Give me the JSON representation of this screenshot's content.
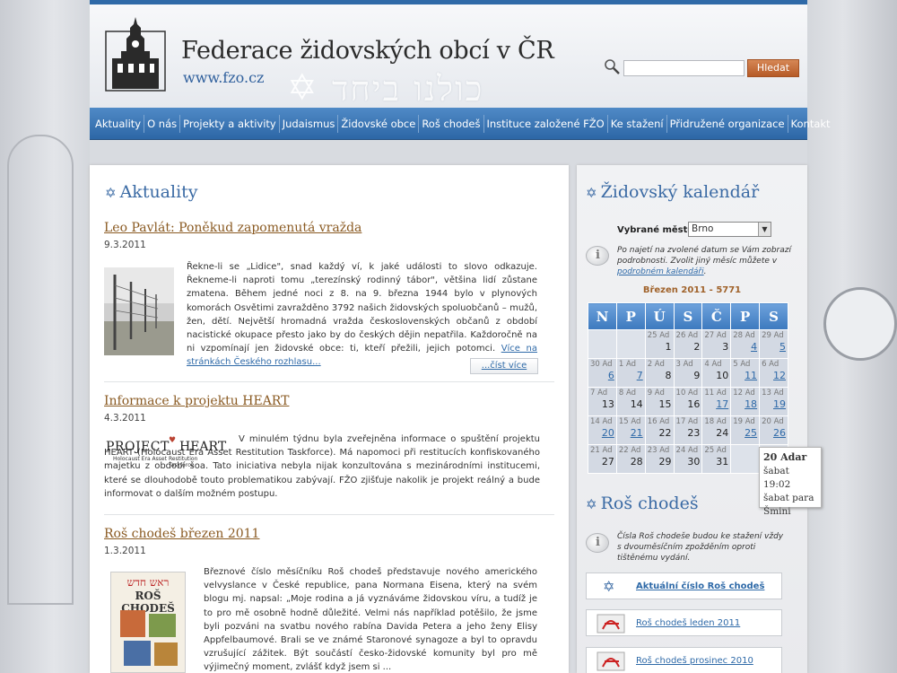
{
  "site": {
    "title": "Federace židovských obcí v ČR",
    "url": "www.fzo.cz",
    "hebrew_motto": "כולנו ביחד"
  },
  "search": {
    "placeholder": "",
    "button_label": "Hledat"
  },
  "nav": [
    "Aktuality",
    "O nás",
    "Projekty a aktivity",
    "Judaismus",
    "Židovské obce",
    "Roš chodeš",
    "Instituce založené FŽO",
    "Ke stažení",
    "Přidružené organizace",
    "Kontakt"
  ],
  "news": {
    "heading": "Aktuality",
    "articles": [
      {
        "title": "Leo Pavlát: Poněkud zapomenutá vražda",
        "date": "9.3.2011",
        "body": "Řekne-li se „Lidice\", snad každý ví, k jaké události to slovo odkazuje. Řekneme-li naproti tomu „terezínský rodinný tábor\", většina lidí zůstane zmatena. Během jedné noci z 8. na 9. března 1944 bylo v plynových komorách Osvětimi zavražděno 3792 našich židovských spoluobčanů – mužů, žen, dětí. Největší hromadná vražda československých občanů z období nacistické okupace přesto jako by do českých dějin nepatřila. Každoročně na ni vzpomínají jen židovské obce: ti, kteří přežili, jejich potomci. ",
        "link": "Více na stránkách Českého rozhlasu...",
        "more": "...číst více"
      },
      {
        "title": "Informace k projektu HEART",
        "date": "4.3.2011",
        "body": "V minulém týdnu byla zveřejněna informace o spuštění projektu HEART (Holocaust Era Asset Restitution Taskforce). Má napomoci při restitucích konfiskovaného majetku z období šoa. Tato iniciativa nebyla nijak konzultována s mezinárodními institucemi, které se dlouhodobě touto problematikou zabývají. FŽO zjišťuje nakolik je projekt reálný a bude informovat o dalším možném postupu.",
        "logo_main": "PROJECT",
        "logo_heart": "HEART",
        "logo_sub1": "Holocaust Era Asset",
        "logo_sub2": "Restitution Taskforce"
      },
      {
        "title": "Roš chodeš březen 2011",
        "date": "1.3.2011",
        "body": "Březnové číslo měsíčníku Roš chodeš představuje nového amerického velvyslance v České republice, pana Normana Eisena, který na svém blogu mj. napsal: „Moje rodina a já vyznáváme židovskou víru, a tudíž je to pro mě osobně hodně důležité. Velmi nás například potěšilo, že jsme byli pozváni na svatbu nového rabína Davida Petera a jeho ženy Elisy Appfelbaumové. Brali se ve známé Staronové synagoze a byl to opravdu vzrušující zážitek. Být součástí česko-židovské komunity byl pro mě výjimečný moment, zvlášť když jsem si ...",
        "cover_hebrew": "ראש חדש",
        "cover_title": "ROŠ CHODEŠ"
      }
    ]
  },
  "calendar": {
    "heading": "Židovský kalendář",
    "city_label": "Vybrané město:",
    "city_value": "Brno",
    "info_text": "Po najetí na zvolené datum se Vám zobrazí podrobnosti. Zvolit jiný měsíc můžete v ",
    "info_link": "podrobném kalendáři",
    "info_end": ".",
    "month": "Březen 2011 - 5771",
    "weekdays": [
      "N",
      "P",
      "Ú",
      "S",
      "Č",
      "P",
      "S"
    ],
    "weeks": [
      [
        null,
        null,
        {
          "h": "25 Ad",
          "d": "1"
        },
        {
          "h": "26 Ad",
          "d": "2"
        },
        {
          "h": "27 Ad",
          "d": "3"
        },
        {
          "h": "28 Ad",
          "d": "4",
          "sat": true
        },
        {
          "h": "29 Ad",
          "d": "5",
          "sat": true
        }
      ],
      [
        {
          "h": "30 Ad",
          "d": "6",
          "sat": true
        },
        {
          "h": "1 Ad",
          "d": "7",
          "sat": true
        },
        {
          "h": "2 Ad",
          "d": "8"
        },
        {
          "h": "3 Ad",
          "d": "9"
        },
        {
          "h": "4 Ad",
          "d": "10"
        },
        {
          "h": "5 Ad",
          "d": "11",
          "sat": true
        },
        {
          "h": "6 Ad",
          "d": "12",
          "sat": true
        }
      ],
      [
        {
          "h": "7 Ad",
          "d": "13"
        },
        {
          "h": "8 Ad",
          "d": "14"
        },
        {
          "h": "9 Ad",
          "d": "15"
        },
        {
          "h": "10 Ad",
          "d": "16"
        },
        {
          "h": "11 Ad",
          "d": "17",
          "sat": true
        },
        {
          "h": "12 Ad",
          "d": "18",
          "sat": true
        },
        {
          "h": "13 Ad",
          "d": "19",
          "sat": true
        }
      ],
      [
        {
          "h": "14 Ad",
          "d": "20",
          "sat": true
        },
        {
          "h": "15 Ad",
          "d": "21",
          "sat": true
        },
        {
          "h": "16 Ad",
          "d": "22"
        },
        {
          "h": "17 Ad",
          "d": "23"
        },
        {
          "h": "18 Ad",
          "d": "24"
        },
        {
          "h": "19 Ad",
          "d": "25",
          "sat": true
        },
        {
          "h": "20 Ad",
          "d": "26",
          "sat": true
        }
      ],
      [
        {
          "h": "21 Ad",
          "d": "27"
        },
        {
          "h": "22 Ad",
          "d": "28"
        },
        {
          "h": "23 Ad",
          "d": "29"
        },
        {
          "h": "24 Ad",
          "d": "30"
        },
        {
          "h": "25 Ad",
          "d": "31"
        },
        null,
        null
      ]
    ],
    "tooltip": {
      "title": "20 Adar",
      "line1": "šabat 19:02",
      "line2": "šabat para",
      "line3": "Šmini"
    }
  },
  "rosh": {
    "heading": "Roš chodeš",
    "info_text": "Čísla Roš chodeše budou ke stažení vždy s dvouměsíčním zpožděním oproti tištěnému vydání.",
    "current_label": "Aktuální číslo Roš chodeš",
    "items": [
      "Roš chodeš leden 2011",
      "Roš chodeš prosinec 2010"
    ]
  }
}
